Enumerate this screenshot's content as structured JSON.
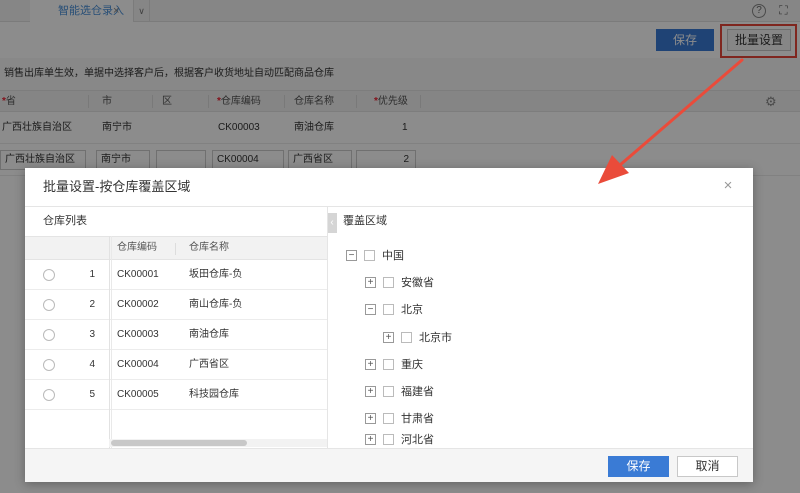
{
  "tab": {
    "title": "智能选仓录入",
    "close": "×",
    "more": "∨"
  },
  "header_icons": {
    "help": "?",
    "fullscreen": "⛶"
  },
  "toolbar": {
    "save_label": "保存",
    "batch_label": "批量设置"
  },
  "notice": "销售出库单生效，单据中选择客户后，根据客户收货地址自动匹配商品仓库",
  "grid": {
    "columns": {
      "province": "省",
      "city": "市",
      "district": "区",
      "wh_code": "仓库编码",
      "wh_name": "仓库名称",
      "priority": "优先级"
    },
    "required_mark": "*",
    "rows": [
      {
        "province": "广西壮族自治区",
        "city": "南宁市",
        "district": "",
        "wh_code": "CK00003",
        "wh_name": "南油仓库",
        "priority": "1"
      },
      {
        "province": "广西壮族自治区",
        "city": "南宁市",
        "district": "",
        "wh_code": "CK00004",
        "wh_name": "广西省区",
        "priority": "2"
      }
    ]
  },
  "modal": {
    "title": "批量设置-按仓库覆盖区域",
    "close": "×",
    "left_title": "仓库列表",
    "right_title": "覆盖区域",
    "collapse": "‹",
    "columns": {
      "code": "仓库编码",
      "name": "仓库名称"
    },
    "warehouses": [
      {
        "num": "1",
        "code": "CK00001",
        "name": "坂田仓库-负"
      },
      {
        "num": "2",
        "code": "CK00002",
        "name": "南山仓库-负"
      },
      {
        "num": "3",
        "code": "CK00003",
        "name": "南油仓库"
      },
      {
        "num": "4",
        "code": "CK00004",
        "name": "广西省区"
      },
      {
        "num": "5",
        "code": "CK00005",
        "name": "科技园仓库"
      }
    ],
    "tree": [
      {
        "label": "中国",
        "toggle": "−"
      },
      {
        "label": "安徽省",
        "toggle": "+"
      },
      {
        "label": "北京",
        "toggle": "−"
      },
      {
        "label": "北京市",
        "toggle": "+"
      },
      {
        "label": "重庆",
        "toggle": "+"
      },
      {
        "label": "福建省",
        "toggle": "+"
      },
      {
        "label": "甘肃省",
        "toggle": "+"
      },
      {
        "label": "河北省",
        "toggle": "+"
      }
    ],
    "ok_label": "保存",
    "cancel_label": "取消"
  },
  "colors": {
    "primary": "#3a7bd5",
    "highlight": "#e8463a"
  }
}
